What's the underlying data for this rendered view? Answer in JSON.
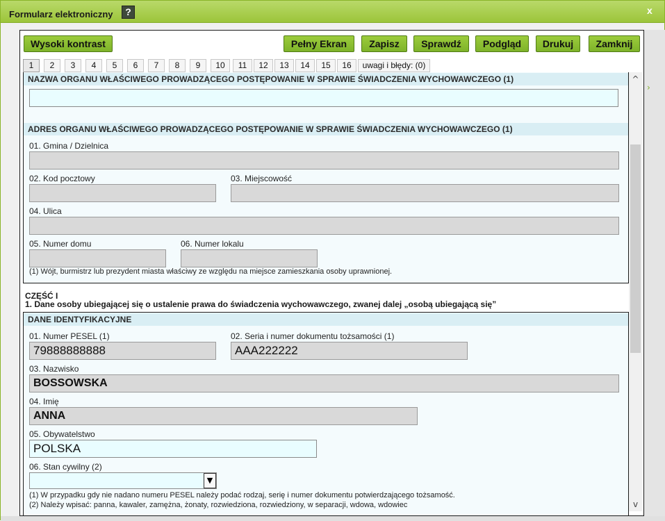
{
  "window": {
    "title": "Formularz elektroniczny",
    "help": "?",
    "close": "x"
  },
  "toolbar": {
    "contrast": "Wysoki kontrast",
    "fullscreen": "Pełny Ekran",
    "save": "Zapisz",
    "check": "Sprawdź",
    "preview": "Podgląd",
    "print": "Drukuj",
    "close": "Zamknij"
  },
  "tabs": [
    "1",
    "2",
    "3",
    "4",
    "5",
    "6",
    "7",
    "8",
    "9",
    "10",
    "11",
    "12",
    "13",
    "14",
    "15",
    "16"
  ],
  "tabs_extra": "uwagi i błędy: (0)",
  "organ": {
    "name_header": "NAZWA ORGANU WŁAŚCIWEGO PROWADZĄCEGO POSTĘPOWANIE W SPRAWIE ŚWIADCZENIA WYCHOWAWCZEGO (1)",
    "name_value": "",
    "address_header": "ADRES ORGANU WŁAŚCIWEGO PROWADZĄCEGO POSTĘPOWANIE W SPRAWIE ŚWIADCZENIA WYCHOWAWCZEGO (1)",
    "gmina_label": "01. Gmina / Dzielnica",
    "kod_label": "02. Kod pocztowy",
    "miejscowosc_label": "03. Miejscowość",
    "ulica_label": "04. Ulica",
    "nr_domu_label": "05. Numer domu",
    "nr_lokalu_label": "06. Numer lokalu",
    "footnote": "(1)  Wójt, burmistrz lub prezydent miasta właściwy ze względu na miejsce zamieszkania osoby uprawnionej."
  },
  "part1": {
    "title": "CZĘŚĆ I",
    "subtitle": "1. Dane osoby ubiegającej się o ustalenie prawa do świadczenia wychowawczego, zwanej dalej „osobą ubiegającą się”"
  },
  "identity": {
    "header": "DANE IDENTYFIKACYJNE",
    "pesel_label": "01. Numer PESEL (1)",
    "pesel_value": "79888888888",
    "doc_label": "02. Seria i numer dokumentu tożsamości (1)",
    "doc_value": "AAA222222",
    "surname_label": "03. Nazwisko",
    "surname_value": "BOSSOWSKA",
    "name_label": "04. Imię",
    "name_value": "ANNA",
    "citizenship_label": "05. Obywatelstwo",
    "citizenship_value": "POLSKA",
    "marital_label": "06. Stan cywilny (2)",
    "marital_value": "",
    "note1": "(1)  W przypadku gdy nie nadano numeru PESEL należy podać rodzaj, serię i numer dokumentu potwierdzającego tożsamość.",
    "note2": "(2)  Należy wpisać: panna, kawaler, zamężna, żonaty, rozwiedziona, rozwiedziony, w separacji, wdowa, wdowiec"
  },
  "colors": {
    "accent": "#8fbf34",
    "section_bg": "#d9eef4",
    "editable_bg": "#e9fdff",
    "readonly_bg": "#d9d9d9"
  }
}
